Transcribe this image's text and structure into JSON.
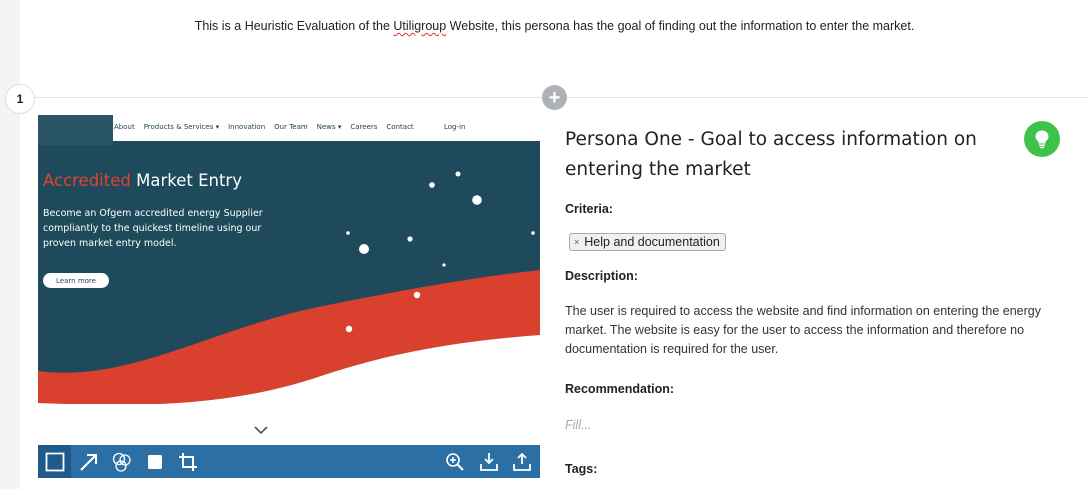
{
  "intro": {
    "text_before": "This is a Heuristic Evaluation of the ",
    "text_link": "Utiligroup",
    "text_after": " Website, this persona has the goal of finding out the information to enter the market."
  },
  "item": {
    "number": "1",
    "add_symbol": "+"
  },
  "screenshot": {
    "nav": [
      "About",
      "Products & Services ▾",
      "Innovation",
      "Our Team",
      "News ▾",
      "Careers",
      "Contact"
    ],
    "login": "Log-in",
    "hero_accent": "Accredited",
    "hero_rest": " Market Entry",
    "hero_desc": "Become an Ofgem accredited energy Supplier compliantly to the quickest timeline using our proven market entry model.",
    "learn_more": "Learn more",
    "colors": {
      "bg": "#1e4a5c",
      "wave": "#d9412e",
      "accent": "#e2412f"
    }
  },
  "toolbar": {
    "tools": [
      "rectangle-icon",
      "arrow-icon",
      "numbered-markers-icon",
      "filled-square-icon",
      "crop-icon"
    ],
    "actions": [
      "zoom-in-icon",
      "download-icon",
      "upload-icon"
    ],
    "color": "#2c6fa4"
  },
  "finding": {
    "title": "Persona One - Goal to access information on entering the market",
    "criteria_label": "Criteria:",
    "criteria_tag": "Help and documentation",
    "tag_remove": "×",
    "description_label": "Description:",
    "description": "The user is required to access the website and find information on entering the energy market. The website is easy for the user to access the information and therefore no documentation is required for the user.",
    "recommendation_label": "Recommendation:",
    "recommendation_placeholder": "Fill...",
    "tags_label": "Tags:"
  }
}
